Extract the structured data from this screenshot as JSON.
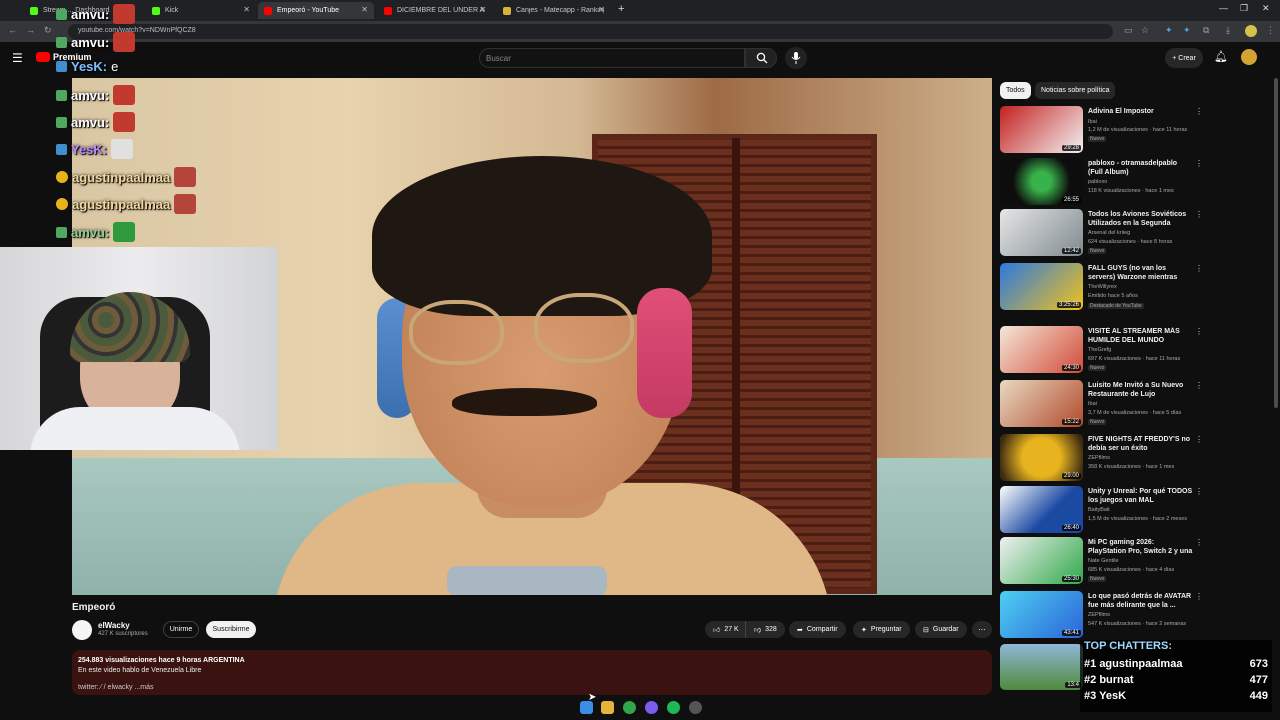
{
  "browser": {
    "tabs": [
      {
        "label": "Stream ... Dashboard"
      },
      {
        "label": "Kick"
      },
      {
        "label": "Empeoró - YouTube"
      },
      {
        "label": "DICIEMBRE DEL UNDER ARGEN..."
      },
      {
        "label": "Canjes - Matecapp - Ranking y..."
      }
    ],
    "new_tab": "+",
    "url": "youtube.com/watch?v=NDWnPfQCZ8"
  },
  "youtube": {
    "logo_text": "Premium",
    "search_placeholder": "Buscar",
    "create_label": "Crear"
  },
  "chat_overlay": [
    {
      "user": "amvu:",
      "type": "emote"
    },
    {
      "user": "amvu:",
      "type": "emote"
    },
    {
      "user": "YesK:",
      "text": "e"
    },
    {
      "user": "amvu:",
      "type": "emote"
    },
    {
      "user": "amvu:",
      "type": "emote"
    },
    {
      "user": "YesK:",
      "type": "emote"
    },
    {
      "user": "agustinpaalmaa",
      "type": "emote"
    },
    {
      "user": "agustinpaalmaa",
      "type": "emote"
    },
    {
      "user": "amvu:",
      "type": "emote"
    }
  ],
  "video": {
    "title": "Empeoró",
    "channel": "elWacky",
    "subscribers": "427 K suscriptores",
    "join_label": "Unirme",
    "subscribe_label": "Suscribirme",
    "likes": "27 K",
    "dislikes": "328",
    "share_label": "Compartir",
    "ask_label": "Preguntar",
    "save_label": "Guardar",
    "desc_stats": "254.883 visualizaciones  hace 9 horas  ARGENTINA",
    "desc_text": "En este video hablo de Venezuela Libre",
    "desc_links": "twitter:  ⁄  / elwacky  ...más"
  },
  "chips": [
    "Todos",
    "Noticias sobre política"
  ],
  "recommendations": [
    {
      "title": "Adivina El Impostor",
      "channel": "Ibai",
      "meta": "1,2 M de visualizaciones · hace 11 horas",
      "badge": "Nuevo",
      "duration": "29:28",
      "colors": [
        "#c42020",
        "#f3f3f3"
      ]
    },
    {
      "title": "pabloxo - otramasdelpablo (Full Album)",
      "channel": "pabloxo",
      "meta": "118 K visualizaciones · hace 1 mes",
      "badge": "",
      "duration": "26:55",
      "colors": [
        "#0d0d0d",
        "#38b24a"
      ]
    },
    {
      "title": "Todos los Aviones Soviéticos Utilizados en la Segunda Guerr...",
      "channel": "Arsenal del kriieg",
      "meta": "624 visualizaciones · hace 8 horas",
      "badge": "Nuevo",
      "duration": "12:42",
      "colors": [
        "#e6e6e6",
        "#7f8a8f"
      ]
    },
    {
      "title": "FALL GUYS (no van los servers) Warzone mientras co...",
      "channel": "TheWillyrex",
      "meta": "Emitido hace 5 años",
      "badge": "Destacado de YouTube",
      "duration": "3:25:26",
      "colors": [
        "#2b79e0",
        "#f2c21a"
      ]
    },
    {
      "title": "VISITÉ AL STREAMER MÁS HUMILDE DEL MUNDO",
      "channel": "TheGrefg",
      "meta": "697 K visualizaciones · hace 11 horas",
      "badge": "Nuevo",
      "duration": "24:30",
      "colors": [
        "#d14b3a",
        "#f4e7d8"
      ]
    },
    {
      "title": "Luisito Me Invitó a Su Nuevo Restaurante de Lujo",
      "channel": "Ibai",
      "meta": "3,7 M de visualizaciones · hace 5 días",
      "badge": "Nuevo",
      "duration": "15:22",
      "colors": [
        "#e8d9c2",
        "#b24a2b"
      ]
    },
    {
      "title": "FIVE NIGHTS AT FREDDY'S no debía ser un éxito",
      "channel": "ZEPfilms",
      "meta": "358 K visualizaciones · hace 1 mes",
      "badge": "",
      "duration": "29:00",
      "colors": [
        "#e7b31e",
        "#3b2a10"
      ]
    },
    {
      "title": "Unity y Unreal: Por qué TODOS los juegos van MAL",
      "channel": "BaityBait",
      "meta": "1,5 M de visualizaciones · hace 2 meses",
      "badge": "",
      "duration": "26:40",
      "colors": [
        "#1b4aa3",
        "#ffffff"
      ]
    },
    {
      "title": "Mi PC gaming 2026: PlayStation Pro, Switch 2 y una RTX 5090 ...",
      "channel": "Nate Gentile",
      "meta": "685 K visualizaciones · hace 4 días",
      "badge": "Nuevo",
      "duration": "25:30",
      "colors": [
        "#f0f0f0",
        "#2fa84a"
      ]
    },
    {
      "title": "Lo que pasó detrás de AVATAR fue más delirante que la ...",
      "channel": "ZEPfilms",
      "meta": "547 K visualizaciones · hace 2 semanas",
      "badge": "",
      "duration": "43:41",
      "colors": [
        "#2a63d8",
        "#4fd0f2"
      ]
    },
    {
      "title": "",
      "channel": "",
      "meta": "",
      "badge": "",
      "duration": "13:4",
      "colors": [
        "#4f8a3c",
        "#8fb8d8"
      ]
    }
  ],
  "top_chatters": {
    "title": "TOP CHATTERS:",
    "rows": [
      {
        "rank": "#1",
        "name": "agustinpaalmaa",
        "count": "673"
      },
      {
        "rank": "#2",
        "name": "burnat",
        "count": "477"
      },
      {
        "rank": "#3",
        "name": "YesK",
        "count": "449"
      }
    ]
  },
  "colors": {
    "accent_red": "#ff0000",
    "desc_bg": "#3a1310",
    "chip_active": "#f1f1f1"
  }
}
